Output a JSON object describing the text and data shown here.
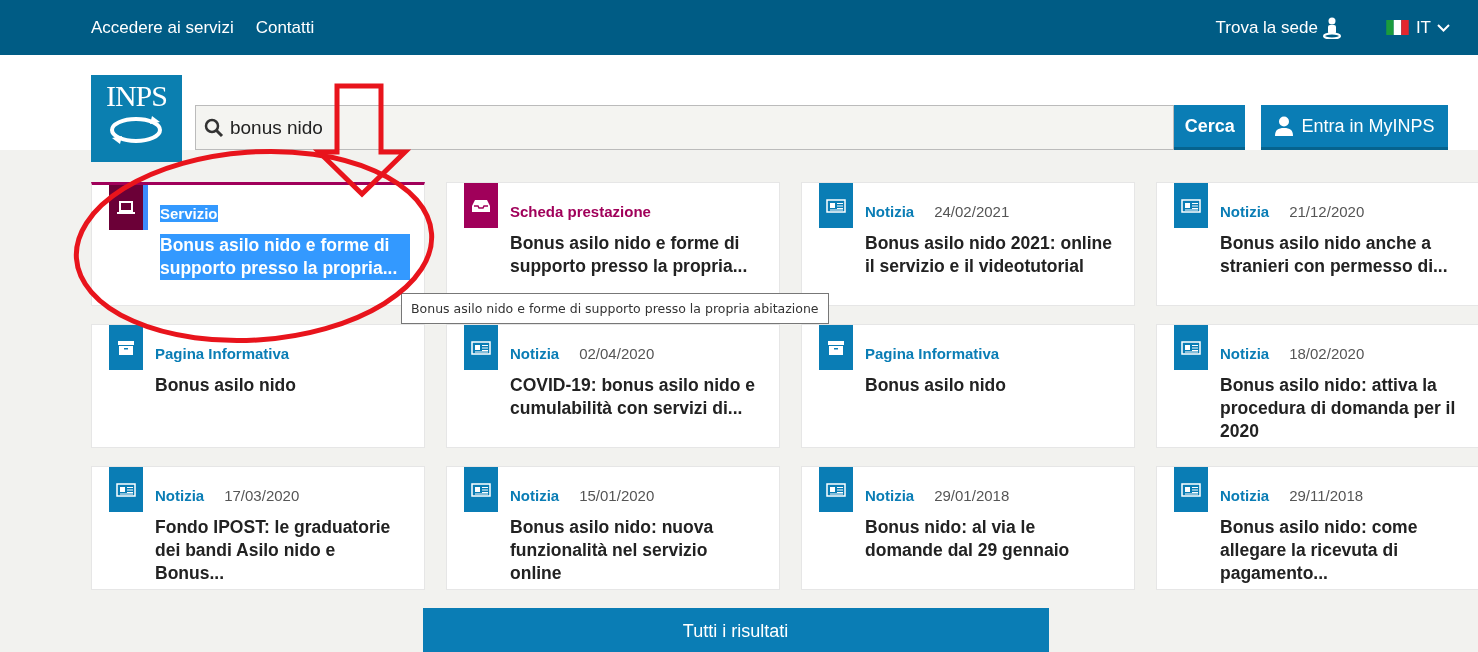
{
  "topbar": {
    "links": [
      "Accedere ai servizi",
      "Contatti"
    ],
    "find_office": "Trova la sede",
    "language": "IT"
  },
  "header": {
    "logo": "INPS",
    "search": {
      "value": "bonus nido",
      "button": "Cerca"
    },
    "login_button": "Entra in MyINPS"
  },
  "results": [
    {
      "kind": "servizio",
      "type": "Servizio",
      "title": "Bonus asilo nido e forme di supporto presso la propria...",
      "selected": true
    },
    {
      "kind": "scheda",
      "type": "Scheda prestazione",
      "title": "Bonus asilo nido e forme di supporto presso la propria...",
      "selected": false
    },
    {
      "kind": "notizia",
      "type": "Notizia",
      "date": "24/02/2021",
      "title": "Bonus asilo nido 2021: online il servizio e il videotutorial",
      "selected": false
    },
    {
      "kind": "notizia",
      "type": "Notizia",
      "date": "21/12/2020",
      "title": "Bonus asilo nido anche a stranieri con permesso di...",
      "selected": false
    },
    {
      "kind": "pagina",
      "type": "Pagina Informativa",
      "title": "Bonus asilo nido",
      "selected": false
    },
    {
      "kind": "notizia",
      "type": "Notizia",
      "date": "02/04/2020",
      "title": "COVID-19: bonus asilo nido e cumulabilità con servizi di...",
      "selected": false
    },
    {
      "kind": "pagina",
      "type": "Pagina Informativa",
      "title": "Bonus asilo nido",
      "selected": false
    },
    {
      "kind": "notizia",
      "type": "Notizia",
      "date": "18/02/2020",
      "title": "Bonus asilo nido: attiva la procedura di domanda per il 2020",
      "selected": false
    },
    {
      "kind": "notizia",
      "type": "Notizia",
      "date": "17/03/2020",
      "title": "Fondo IPOST: le graduatorie dei bandi Asilo nido e Bonus...",
      "selected": false
    },
    {
      "kind": "notizia",
      "type": "Notizia",
      "date": "15/01/2020",
      "title": "Bonus asilo nido: nuova funzionalità nel servizio online",
      "selected": false
    },
    {
      "kind": "notizia",
      "type": "Notizia",
      "date": "29/01/2018",
      "title": "Bonus nido: al via le domande dal 29 gennaio",
      "selected": false
    },
    {
      "kind": "notizia",
      "type": "Notizia",
      "date": "29/11/2018",
      "title": "Bonus asilo nido: come allegare la ricevuta di pagamento...",
      "selected": false
    }
  ],
  "tooltip": "Bonus asilo nido e forme di supporto presso la propria abitazione",
  "all_results_button": "Tutti i risultati"
}
